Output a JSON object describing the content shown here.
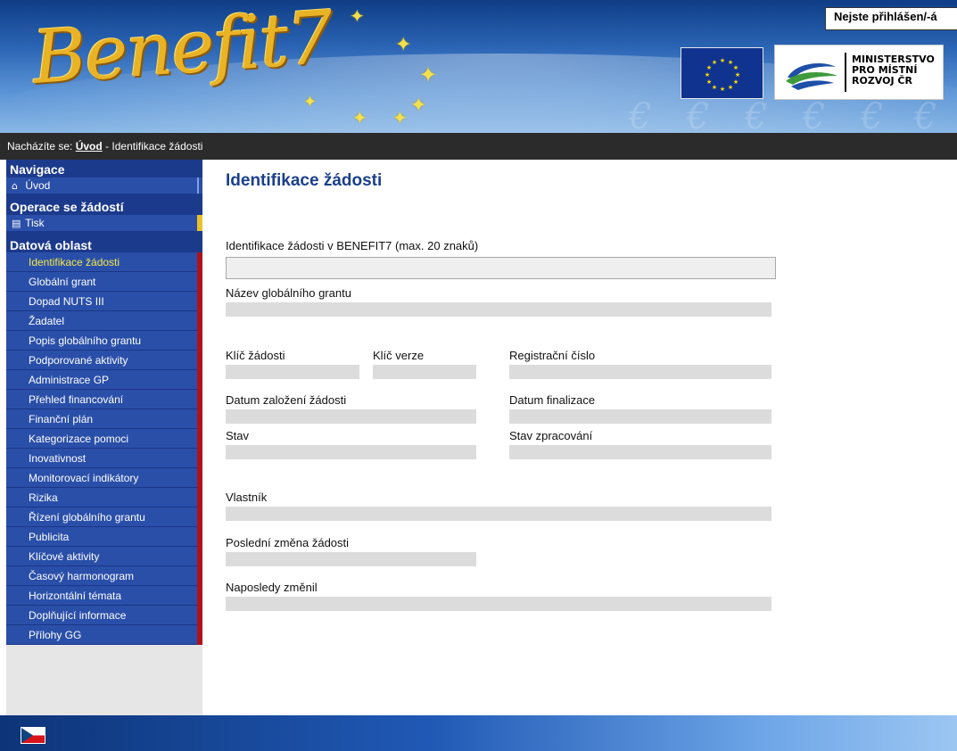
{
  "header": {
    "logo_text": "Benefit7",
    "mmr_name": "MINISTERSTVO\nPRO MÍSTNÍ\nROZVOJ ČR",
    "login_status": "Nejste přihlášen/-á"
  },
  "breadcrumb": {
    "prefix": "Nacházíte se: ",
    "home": "Úvod",
    "current": " - Identifikace žádosti"
  },
  "sidebar": {
    "navigace_title": "Navigace",
    "home_label": "Úvod",
    "operace_title": "Operace se žádostí",
    "print_label": "Tisk",
    "data_title": "Datová oblast",
    "items": [
      {
        "label": "Identifikace žádosti"
      },
      {
        "label": "Globální grant"
      },
      {
        "label": "Dopad NUTS III"
      },
      {
        "label": "Žadatel"
      },
      {
        "label": "Popis globálního grantu"
      },
      {
        "label": "Podporované aktivity"
      },
      {
        "label": "Administrace GP"
      },
      {
        "label": "Přehled financování"
      },
      {
        "label": "Finanční plán"
      },
      {
        "label": "Kategorizace pomoci"
      },
      {
        "label": "Inovativnost"
      },
      {
        "label": "Monitorovací indikátory"
      },
      {
        "label": "Rizika"
      },
      {
        "label": "Řízení globálního grantu"
      },
      {
        "label": "Publicita"
      },
      {
        "label": "Klíčové aktivity"
      },
      {
        "label": "Časový harmonogram"
      },
      {
        "label": "Horizontální témata"
      },
      {
        "label": "Doplňující informace"
      },
      {
        "label": "Přílohy GG"
      }
    ]
  },
  "main": {
    "title": "Identifikace žádosti",
    "labels": {
      "identifikace": "Identifikace žádosti v BENEFIT7 (max. 20 znaků)",
      "nazev": "Název globálního grantu",
      "klic_zadosti": "Klíč žádosti",
      "klic_verze": "Klíč verze",
      "registracni_cislo": "Registrační číslo",
      "datum_zalozeni": "Datum založení žádosti",
      "datum_finalizace": "Datum finalizace",
      "stav": "Stav",
      "stav_zpracovani": "Stav zpracování",
      "vlastnik": "Vlastník",
      "posledni_zmena": "Poslední změna žádosti",
      "naposledy_zmenil": "Naposledy změnil"
    },
    "values": {
      "identifikace": ""
    }
  },
  "colors": {
    "nav_bg": "#2a4fa9",
    "accent_red": "#b0121b",
    "active_text": "#f5e94a",
    "title_blue": "#1b3f8c"
  }
}
